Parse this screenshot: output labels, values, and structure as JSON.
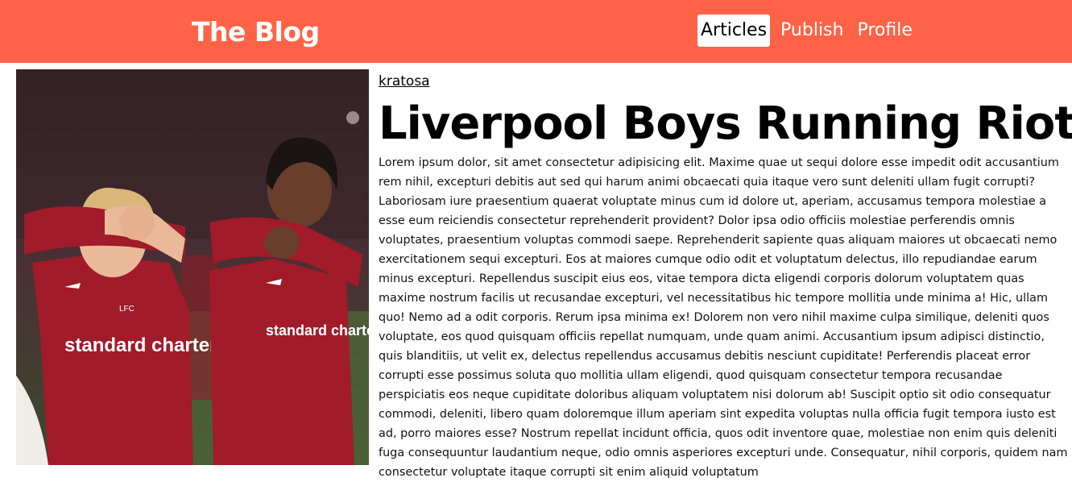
{
  "header": {
    "brand": "The Blog",
    "nav": [
      {
        "label": "Articles",
        "active": true
      },
      {
        "label": "Publish",
        "active": false
      },
      {
        "label": "Profile",
        "active": false
      }
    ]
  },
  "colors": {
    "accent": "#ff6347",
    "jersey": "#a11b2a"
  },
  "article": {
    "author": "kratosa",
    "title": "Liverpool Boys Running Riot",
    "image": {
      "description_icon": "football-players-photo",
      "sponsor_text": "standard chartered",
      "crest_text": "LFC"
    },
    "body": "Lorem ipsum dolor, sit amet consectetur adipisicing elit. Maxime quae ut sequi dolore esse impedit odit accusantium rem nihil, excepturi debitis aut sed qui harum animi obcaecati quia itaque vero sunt deleniti ullam fugit corrupti? Laboriosam iure praesentium quaerat voluptate minus cum id dolore ut, aperiam, accusamus tempora molestiae a esse eum reiciendis consectetur reprehenderit provident? Dolor ipsa odio officiis molestiae perferendis omnis voluptates, praesentium voluptas commodi saepe. Reprehenderit sapiente quas aliquam maiores ut obcaecati nemo exercitationem sequi excepturi. Eos at maiores cumque odio odit et voluptatum delectus, illo repudiandae earum minus excepturi. Repellendus suscipit eius eos, vitae tempora dicta eligendi corporis dolorum voluptatem quas maxime nostrum facilis ut recusandae excepturi, vel necessitatibus hic tempore mollitia unde minima a! Hic, ullam quo! Nemo ad a odit corporis. Rerum ipsa minima ex! Dolorem non vero nihil maxime culpa similique, deleniti quos voluptate, eos quod quisquam officiis repellat numquam, unde quam animi. Accusantium ipsum adipisci distinctio, quis blanditiis, ut velit ex, delectus repellendus accusamus debitis nesciunt cupiditate! Perferendis placeat error corrupti esse possimus soluta quo mollitia ullam eligendi, quod quisquam consectetur tempora recusandae perspiciatis eos neque cupiditate doloribus aliquam voluptatem nisi dolorum ab! Suscipit optio sit odio consequatur commodi, deleniti, libero quam doloremque illum aperiam sint expedita voluptas nulla officia fugit tempora iusto est ad, porro maiores esse? Nostrum repellat incidunt officia, quos odit inventore quae, molestiae non enim quis deleniti fuga consequuntur laudantium neque, odio omnis asperiores excepturi unde. Consequatur, nihil corporis, quidem nam consectetur voluptate itaque corrupti sit enim aliquid voluptatum"
  }
}
